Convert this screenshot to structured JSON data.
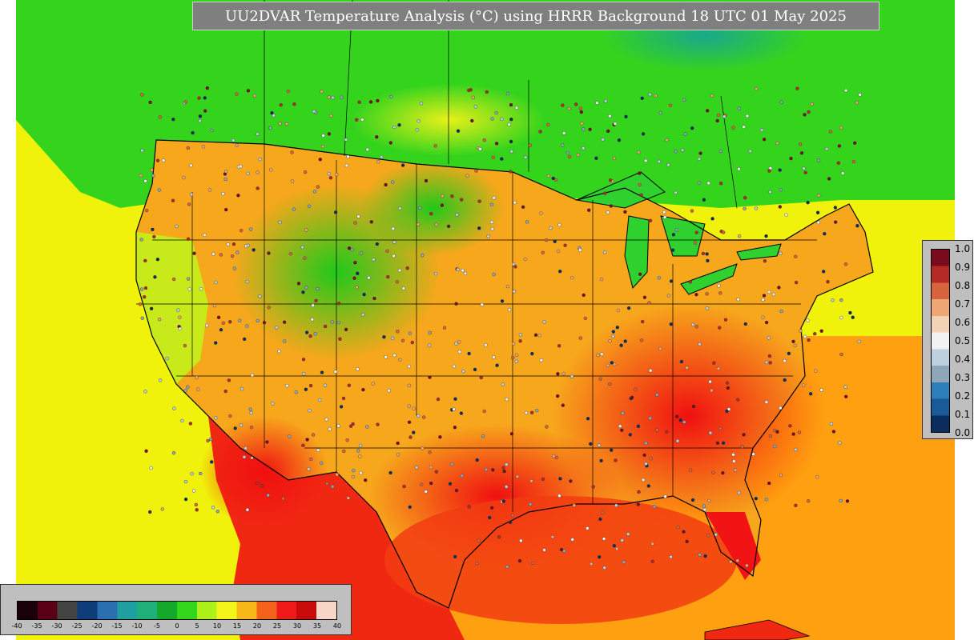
{
  "title": "UU2DVAR Temperature Analysis (°C) using HRRR Background 18 UTC 01 May 2025",
  "quality_colorbar": {
    "ticks": [
      "0.0",
      "0.1",
      "0.2",
      "0.3",
      "0.4",
      "0.5",
      "0.6",
      "0.7",
      "0.8",
      "0.9",
      "1.0"
    ],
    "colors": [
      "#0b2d5e",
      "#1a5a98",
      "#2c7fb8",
      "#8fa6b8",
      "#bcd0df",
      "#f2f2f2",
      "#f3d3b6",
      "#eea674",
      "#d8643d",
      "#b42a24",
      "#7a0b1e"
    ]
  },
  "temperature_colorbar": {
    "ticks": [
      "-40",
      "-35",
      "-30",
      "-25",
      "-20",
      "-15",
      "-10",
      "-5",
      "0",
      "5",
      "10",
      "15",
      "20",
      "25",
      "30",
      "35",
      "40"
    ],
    "colors": [
      "#1a0008",
      "#5a0016",
      "#444444",
      "#0f3d7a",
      "#2b6fb0",
      "#1f9fa0",
      "#1fb07a",
      "#16a82a",
      "#33d61a",
      "#aef01a",
      "#f4f41a",
      "#f8b81a",
      "#f4611a",
      "#ee1a1a",
      "#c80a0a",
      "#f7d6c8"
    ]
  },
  "map_colors": {
    "ocean_west": "#f0f20c",
    "ocean_south": "#ff9a10",
    "gulf": "#f23a10",
    "canada_north": "#33d61a",
    "canada_teal": "#1fb07a",
    "lakes": "#2fd12f"
  }
}
